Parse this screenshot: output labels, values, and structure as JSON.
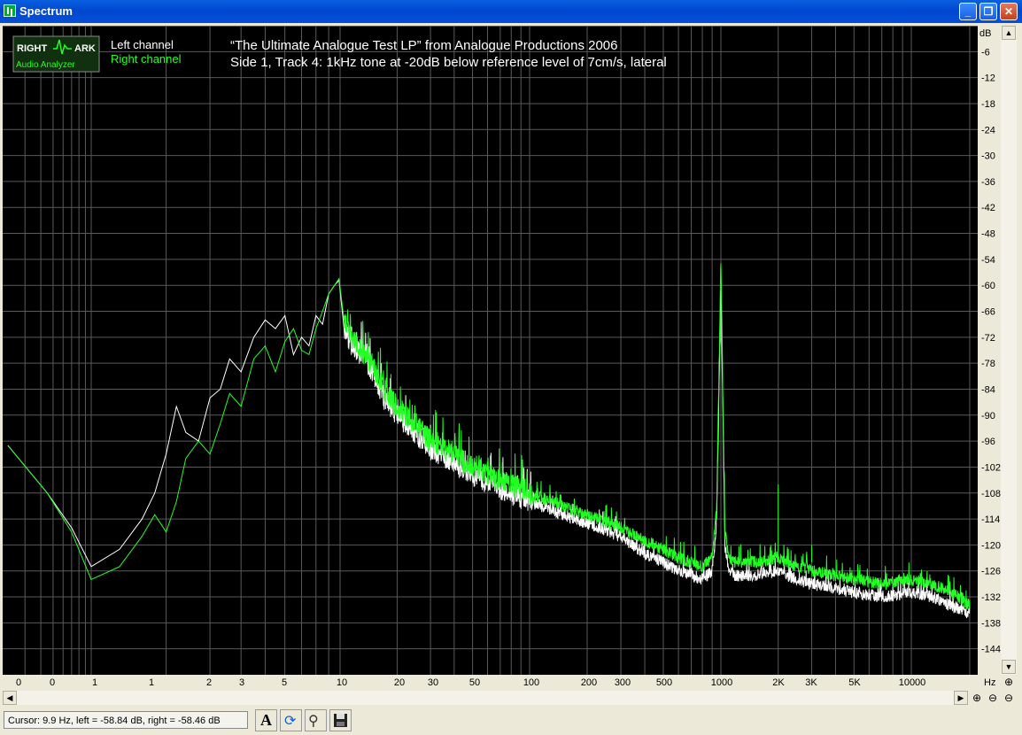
{
  "window": {
    "title": "Spectrum",
    "minimize_label": "_",
    "restore_label": "❐",
    "close_label": "✕"
  },
  "chart_data": {
    "type": "line",
    "title": "“The Ultimate Analogue Test LP” from Analogue Productions 2006",
    "subtitle": "Side 1, Track 4: 1kHz tone at -20dB below reference level of 7cm/s, lateral",
    "logo_text": {
      "top_left": "RIGHT",
      "top_right": "ARK",
      "bottom": "Audio Analyzer"
    },
    "x_unit_label": "Hz",
    "y_unit_label": "dB",
    "x_scale": "log",
    "x_tick_labels": [
      "0",
      "0",
      "1",
      "1",
      "2",
      "3",
      "5",
      "10",
      "20",
      "30",
      "50",
      "100",
      "200",
      "300",
      "500",
      "1000",
      "2K",
      "3K",
      "5K",
      "10000"
    ],
    "y_ticks": [
      -6,
      -12,
      -18,
      -24,
      -30,
      -36,
      -42,
      -48,
      -54,
      -60,
      -66,
      -72,
      -78,
      -84,
      -90,
      -96,
      -102,
      -108,
      -114,
      -120,
      -126,
      -132,
      -138,
      -144
    ],
    "ylim": [
      -150,
      0
    ],
    "grid": true,
    "legend_position": "top-left",
    "colors": {
      "background": "#000000",
      "grid": "#5a5a5a",
      "left": "#ffffff",
      "right": "#22ff22",
      "text": "#ffffff"
    },
    "series": [
      {
        "name": "Left channel",
        "color": "#ffffff",
        "x": [
          0.22,
          0.45,
          0.7,
          1.0,
          1.3,
          1.6,
          1.8,
          2.0,
          2.2,
          2.4,
          2.7,
          3.0,
          3.3,
          3.6,
          4.0,
          4.5,
          5.0,
          5.5,
          6.0,
          6.5,
          7.0,
          7.5,
          8.0,
          8.5,
          9.0,
          9.5,
          9.9,
          10.5,
          11.5,
          13,
          15,
          17,
          20,
          25,
          30,
          40,
          50,
          70,
          100,
          150,
          200,
          300,
          400,
          500,
          600,
          700,
          800,
          900,
          950,
          1000,
          1050,
          1100,
          1200,
          1500,
          2000,
          2500,
          3000,
          4000,
          5000,
          7000,
          10000,
          13000,
          16000,
          20000
        ],
        "y": [
          -97,
          -108,
          -116,
          -125,
          -121,
          -114,
          -108,
          -99,
          -88,
          -94,
          -96,
          -86,
          -84,
          -77,
          -80,
          -72,
          -68,
          -70,
          -67,
          -76,
          -72,
          -74,
          -67,
          -69,
          -62,
          -60,
          -58.84,
          -70,
          -74,
          -76,
          -80,
          -86,
          -90,
          -94,
          -98,
          -101,
          -104,
          -107,
          -110,
          -113,
          -115,
          -118,
          -122,
          -124,
          -126,
          -127,
          -128,
          -126,
          -115,
          -60,
          -120,
          -126,
          -127,
          -127,
          -126,
          -128,
          -129,
          -130,
          -131,
          -132,
          -131,
          -132,
          -134,
          -136
        ]
      },
      {
        "name": "Right channel",
        "color": "#22ff22",
        "x": [
          0.22,
          0.45,
          0.7,
          1.0,
          1.3,
          1.6,
          1.8,
          2.0,
          2.2,
          2.4,
          2.7,
          3.0,
          3.3,
          3.6,
          4.0,
          4.5,
          5.0,
          5.5,
          6.0,
          6.5,
          7.0,
          7.5,
          8.0,
          8.5,
          9.0,
          9.5,
          9.9,
          10.5,
          11.5,
          13,
          15,
          17,
          20,
          25,
          30,
          40,
          50,
          70,
          100,
          150,
          200,
          300,
          400,
          500,
          600,
          700,
          800,
          900,
          950,
          1000,
          1050,
          1100,
          1200,
          1500,
          2000,
          2500,
          3000,
          4000,
          5000,
          7000,
          10000,
          13000,
          16000,
          20000
        ],
        "y": [
          -97,
          -108,
          -117,
          -128,
          -125,
          -118,
          -113,
          -117,
          -110,
          -100,
          -96,
          -99,
          -92,
          -85,
          -88,
          -77,
          -74,
          -80,
          -73,
          -70,
          -75,
          -76,
          -70,
          -66,
          -62,
          -60,
          -58.46,
          -68,
          -72,
          -75,
          -79,
          -84,
          -88,
          -92,
          -96,
          -99,
          -102,
          -105,
          -108,
          -111,
          -113,
          -116,
          -119,
          -121,
          -123,
          -124,
          -125,
          -123,
          -112,
          -54,
          -117,
          -123,
          -124,
          -124,
          -123,
          -125,
          -126,
          -127,
          -128,
          -129,
          -128,
          -129,
          -131,
          -134
        ]
      }
    ]
  },
  "status": {
    "cursor_text": "Cursor:  9.9 Hz,  left = -58.84 dB,  right = -58.46 dB",
    "toolbar": [
      "font-icon",
      "refresh-icon",
      "search-icon",
      "save-icon"
    ]
  }
}
